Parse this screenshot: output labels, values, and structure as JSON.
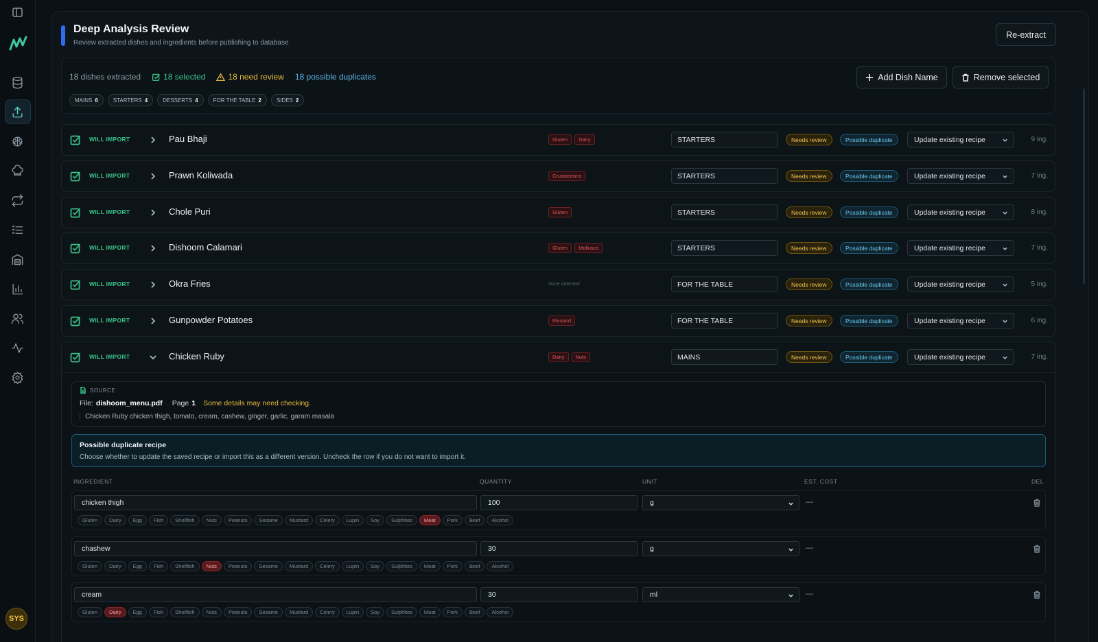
{
  "sidebar": {
    "avatar": "SYS",
    "icons": [
      "panel-toggle-icon",
      "logo-icon",
      "database-icon",
      "upload-icon",
      "brain-icon",
      "chef-hat-icon",
      "repeat-icon",
      "list-icon",
      "warehouse-icon",
      "bar-chart-icon",
      "users-icon",
      "activity-icon",
      "gear-icon"
    ]
  },
  "header": {
    "title": "Deep Analysis Review",
    "subtitle": "Review extracted dishes and ingredients before publishing to database",
    "reextract_label": "Re-extract"
  },
  "summary": {
    "extracted": "18 dishes extracted",
    "selected": "18 selected",
    "need_review": "18 need review",
    "duplicates": "18 possible duplicates",
    "add_label": "Add Dish Name",
    "remove_label": "Remove selected",
    "categories": [
      {
        "name": "MAINS",
        "count": "6"
      },
      {
        "name": "STARTERS",
        "count": "4"
      },
      {
        "name": "DESSERTS",
        "count": "4"
      },
      {
        "name": "FOR THE TABLE",
        "count": "2"
      },
      {
        "name": "SIDES",
        "count": "2"
      }
    ]
  },
  "row_labels": {
    "will_import": "WILL IMPORT",
    "needs_review": "Needs review",
    "possible_duplicate": "Possible duplicate",
    "none_detected": "None detected"
  },
  "dishes": [
    {
      "name": "Pau Bhaji",
      "allergens": [
        "Gluten",
        "Dairy"
      ],
      "category": "STARTERS",
      "action": "Update existing recipe",
      "ingredients": "9 ing."
    },
    {
      "name": "Prawn Koliwada",
      "allergens": [
        "Crustaceans"
      ],
      "category": "STARTERS",
      "action": "Update existing recipe",
      "ingredients": "7 ing."
    },
    {
      "name": "Chole Puri",
      "allergens": [
        "Gluten"
      ],
      "category": "STARTERS",
      "action": "Update existing recipe",
      "ingredients": "8 ing."
    },
    {
      "name": "Dishoom Calamari",
      "allergens": [
        "Gluten",
        "Molluscs"
      ],
      "category": "STARTERS",
      "action": "Update existing recipe",
      "ingredients": "7 ing."
    },
    {
      "name": "Okra Fries",
      "allergens": [],
      "category": "FOR THE TABLE",
      "action": "Update existing recipe",
      "ingredients": "5 ing."
    },
    {
      "name": "Gunpowder Potatoes",
      "allergens": [
        "Mustard"
      ],
      "category": "FOR THE TABLE",
      "action": "Update existing recipe",
      "ingredients": "6 ing."
    },
    {
      "name": "Chicken Ruby",
      "allergens": [
        "Dairy",
        "Nuts"
      ],
      "category": "MAINS",
      "action": "Update existing recipe",
      "ingredients": "7 ing."
    }
  ],
  "source": {
    "label": "SOURCE",
    "file_label": "File:",
    "file": "dishoom_menu.pdf",
    "page_label": "Page",
    "page": "1",
    "warning": "Some details may need checking.",
    "excerpt": "Chicken Ruby chicken thigh, tomato, cream, cashew, ginger, garlic, garam masala"
  },
  "duplicate_notice": {
    "title": "Possible duplicate recipe",
    "text": "Choose whether to update the saved recipe or import this as a different version. Uncheck the row if you do not want to import it."
  },
  "ingredient_table": {
    "headers": {
      "ingredient": "INGREDIENT",
      "quantity": "QUANTITY",
      "unit": "UNIT",
      "cost": "EST. COST",
      "del": "DEL"
    },
    "allergen_options": [
      "Gluten",
      "Dairy",
      "Egg",
      "Fish",
      "Shellfish",
      "Nuts",
      "Peanuts",
      "Sesame",
      "Mustard",
      "Celery",
      "Lupin",
      "Soy",
      "Sulphites",
      "Meat",
      "Pork",
      "Beef",
      "Alcohol"
    ],
    "rows": [
      {
        "name": "chicken thigh",
        "quantity": "100",
        "unit": "g",
        "cost": "—",
        "active": [
          "Meat"
        ]
      },
      {
        "name": "chashew",
        "quantity": "30",
        "unit": "g",
        "cost": "—",
        "active": [
          "Nuts"
        ]
      },
      {
        "name": "cream",
        "quantity": "30",
        "unit": "ml",
        "cost": "—",
        "active": [
          "Dairy"
        ]
      }
    ]
  },
  "colors": {
    "accent": "#2f6cf0",
    "success": "#3cc289",
    "warning": "#e9b93c",
    "info": "#5db1e6",
    "danger": "#e0575d"
  }
}
